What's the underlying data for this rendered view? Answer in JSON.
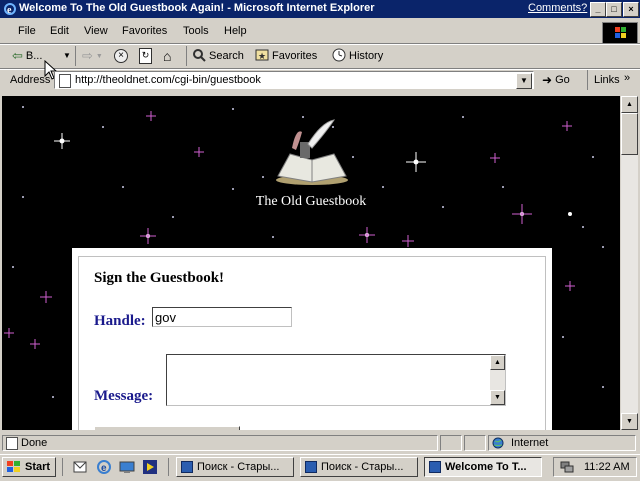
{
  "window": {
    "title": "Welcome To The Old Guestbook Again! - Microsoft Internet Explorer",
    "comments_link": "Comments?"
  },
  "menu": [
    "File",
    "Edit",
    "View",
    "Favorites",
    "Tools",
    "Help"
  ],
  "toolbar": {
    "back_label": "B...",
    "search_label": "Search",
    "favorites_label": "Favorites",
    "history_label": "History"
  },
  "address": {
    "label": "Address",
    "url": "http://theoldnet.com/cgi-bin/guestbook",
    "go_label": "Go",
    "links_label": "Links"
  },
  "page": {
    "site_title": "The Old Guestbook",
    "form_heading": "Sign the Guestbook!",
    "handle_label": "Handle:",
    "handle_value": "gov",
    "message_label": "Message:",
    "message_value": ""
  },
  "status": {
    "text": "Done",
    "zone": "Internet"
  },
  "taskbar": {
    "start_label": "Start",
    "tasks": [
      "Поиск - Стары...",
      "Поиск - Стары...",
      "Welcome To T..."
    ],
    "clock": "11:22 AM"
  },
  "colors": {
    "titlebar": "#0a246a",
    "form_label": "#1a1a8c",
    "page_background": "#000000"
  }
}
